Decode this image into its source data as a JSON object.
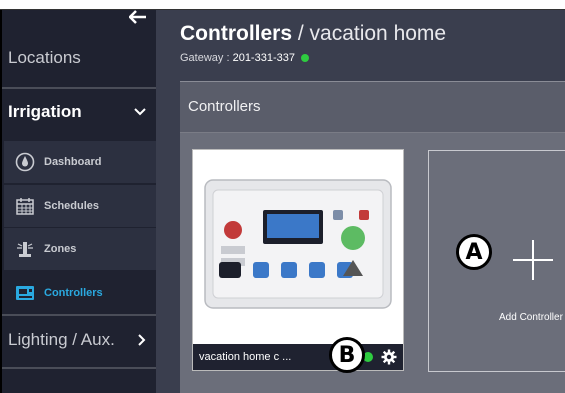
{
  "sidebar": {
    "items": [
      {
        "label": "Locations"
      },
      {
        "label": "Irrigation",
        "expanded": true
      },
      {
        "label": "Lighting / Aux."
      }
    ],
    "sub_items": [
      {
        "label": "Dashboard",
        "icon": "water-drop-icon"
      },
      {
        "label": "Schedules",
        "icon": "calendar-icon"
      },
      {
        "label": "Zones",
        "icon": "sprinkler-icon"
      },
      {
        "label": "Controllers",
        "icon": "controller-icon",
        "active": true
      }
    ]
  },
  "header": {
    "title_bold": "Controllers",
    "title_rest": " / vacation home",
    "gateway_label": "Gateway : ",
    "gateway_value": "201-331-337",
    "gateway_status_color": "#2ecc40"
  },
  "panel": {
    "title": "Controllers",
    "cards": [
      {
        "name": "vacation home c ...",
        "status_color": "#2ecc40"
      }
    ],
    "add_label": "Add Controller"
  },
  "callouts": {
    "a": "A",
    "b": "B"
  },
  "colors": {
    "sidebar_bg": "#1f2230",
    "main_bg": "#3a3e4e",
    "active_accent": "#2aa9e0"
  }
}
